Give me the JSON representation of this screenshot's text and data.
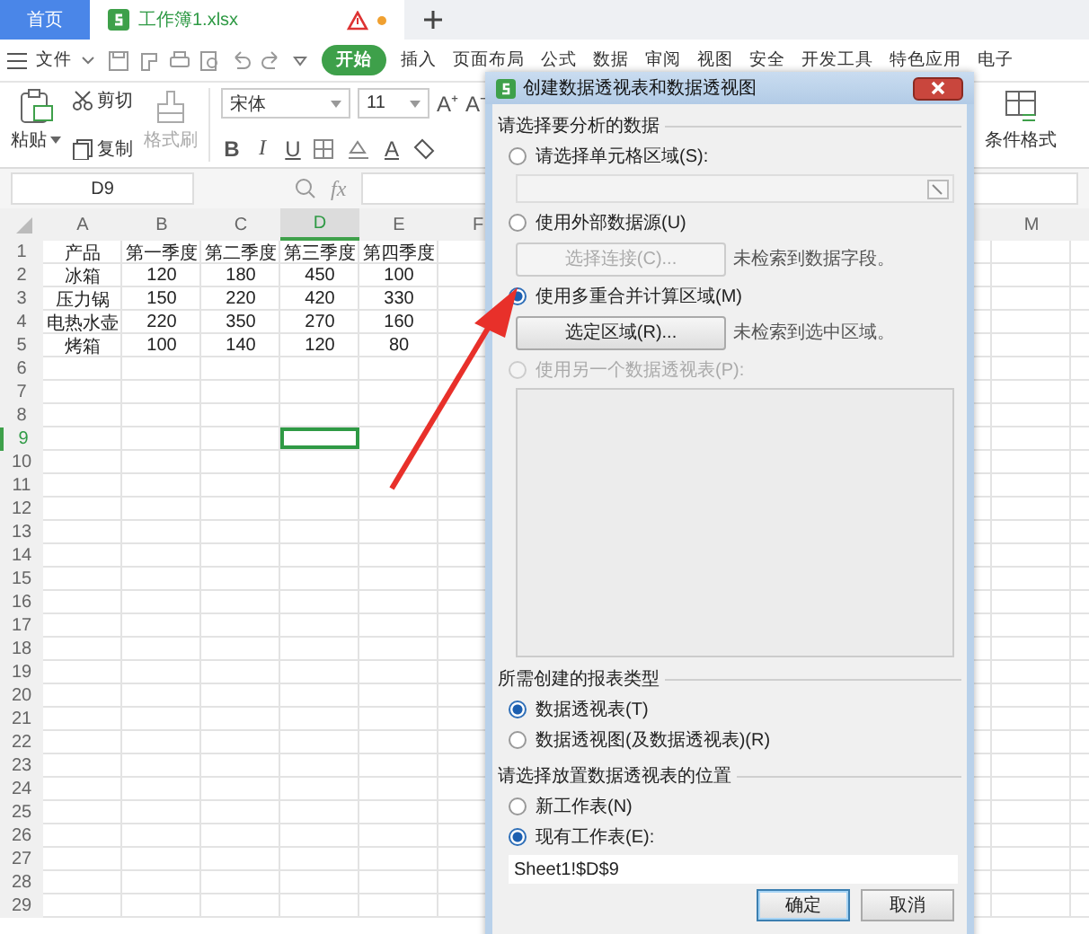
{
  "tabs": [
    {
      "label": "首页",
      "kind": "home",
      "selected": false
    },
    {
      "label": "工作簿1.xlsx",
      "kind": "file",
      "selected": true
    }
  ],
  "menu": {
    "file": "文件",
    "items": [
      {
        "label": "开始",
        "selected": true
      },
      {
        "label": "插入",
        "selected": false
      },
      {
        "label": "页面布局",
        "selected": false
      },
      {
        "label": "公式",
        "selected": false
      },
      {
        "label": "数据",
        "selected": false
      },
      {
        "label": "审阅",
        "selected": false
      },
      {
        "label": "视图",
        "selected": false
      },
      {
        "label": "安全",
        "selected": false
      },
      {
        "label": "开发工具",
        "selected": false
      },
      {
        "label": "特色应用",
        "selected": false
      },
      {
        "label": "电子",
        "selected": false
      }
    ]
  },
  "ribbon": {
    "paste": "粘贴",
    "cut": "剪切",
    "copy": "复制",
    "format_painter": {
      "label": "格式刷",
      "disabled": true
    },
    "font": "宋体",
    "font_size": "11",
    "size_buttons": [
      "A⁺",
      "A⁻"
    ],
    "style_buttons": [
      "B",
      "I",
      "U"
    ],
    "font_color": "A",
    "conditional_format": "条件格式"
  },
  "formula_bar": {
    "name_box": "D9",
    "fx": "fx"
  },
  "sheet": {
    "columns": [
      {
        "label": "A",
        "selected": false
      },
      {
        "label": "B",
        "selected": false
      },
      {
        "label": "C",
        "selected": false
      },
      {
        "label": "D",
        "selected": true
      },
      {
        "label": "E",
        "selected": false
      },
      {
        "label": "F",
        "selected": false
      },
      {
        "label": "M",
        "selected": false
      }
    ],
    "rows": [
      {
        "number": "1",
        "selected": false,
        "cells": [
          "产品",
          "第一季度",
          "第二季度",
          "第三季度",
          "第四季度"
        ]
      },
      {
        "number": "2",
        "selected": false,
        "cells": [
          "冰箱",
          "120",
          "180",
          "450",
          "100"
        ]
      },
      {
        "number": "3",
        "selected": false,
        "cells": [
          "压力锅",
          "150",
          "220",
          "420",
          "330"
        ]
      },
      {
        "number": "4",
        "selected": false,
        "cells": [
          "电热水壶",
          "220",
          "350",
          "270",
          "160"
        ]
      },
      {
        "number": "5",
        "selected": false,
        "cells": [
          "烤箱",
          "100",
          "140",
          "120",
          "80"
        ]
      },
      {
        "number": "6",
        "selected": false
      },
      {
        "number": "7",
        "selected": false
      },
      {
        "number": "8",
        "selected": false
      },
      {
        "number": "9",
        "selected": true
      },
      {
        "number": "10",
        "selected": false
      },
      {
        "number": "11",
        "selected": false
      },
      {
        "number": "12",
        "selected": false
      },
      {
        "number": "13",
        "selected": false
      },
      {
        "number": "14",
        "selected": false
      },
      {
        "number": "15",
        "selected": false
      },
      {
        "number": "16",
        "selected": false
      },
      {
        "number": "17",
        "selected": false
      },
      {
        "number": "18",
        "selected": false
      },
      {
        "number": "19",
        "selected": false
      },
      {
        "number": "20",
        "selected": false
      },
      {
        "number": "21",
        "selected": false
      },
      {
        "number": "22",
        "selected": false
      },
      {
        "number": "23",
        "selected": false
      },
      {
        "number": "24",
        "selected": false
      },
      {
        "number": "25",
        "selected": false
      },
      {
        "number": "26",
        "selected": false
      },
      {
        "number": "27",
        "selected": false
      },
      {
        "number": "28",
        "selected": false
      },
      {
        "number": "29",
        "selected": false
      }
    ]
  },
  "dialog": {
    "title": "创建数据透视表和数据透视图",
    "source": {
      "title": "请选择要分析的数据",
      "items": [
        {
          "kind": "radio",
          "label": "请选择单元格区域(S):",
          "selected": false,
          "disabled": false
        },
        {
          "kind": "range_field",
          "disabled": true
        },
        {
          "kind": "radio",
          "label": "使用外部数据源(U)",
          "selected": false,
          "disabled": false
        },
        {
          "kind": "action",
          "button": "选择连接(C)...",
          "note": "未检索到数据字段。",
          "disabled": true
        },
        {
          "kind": "radio",
          "label": "使用多重合并计算区域(M)",
          "selected": true,
          "disabled": false
        },
        {
          "kind": "action",
          "button": "选定区域(R)...",
          "note": "未检索到选中区域。",
          "disabled": false
        },
        {
          "kind": "radio",
          "label": "使用另一个数据透视表(P):",
          "selected": false,
          "disabled": true
        },
        {
          "kind": "list_box"
        }
      ]
    },
    "report_type": {
      "title": "所需创建的报表类型",
      "options": [
        {
          "label": "数据透视表(T)",
          "selected": true
        },
        {
          "label": "数据透视图(及数据透视表)(R)",
          "selected": false
        }
      ]
    },
    "location": {
      "title": "请选择放置数据透视表的位置",
      "options": [
        {
          "label": "新工作表(N)",
          "selected": false
        },
        {
          "label": "现有工作表(E):",
          "selected": true
        }
      ],
      "target": "Sheet1!$D$9"
    },
    "buttons": [
      {
        "label": "确定",
        "default": true
      },
      {
        "label": "取消",
        "default": false
      }
    ]
  }
}
